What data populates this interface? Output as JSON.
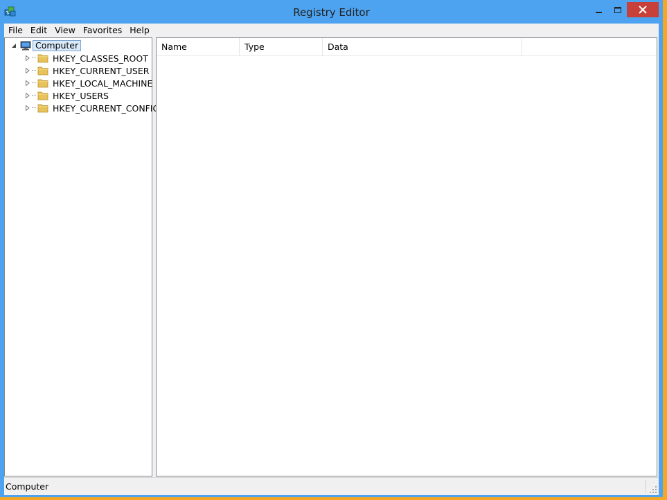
{
  "window": {
    "title": "Registry Editor",
    "accent_color": "#4da3ef",
    "close_color": "#c7403a",
    "desktop_color": "#f5a623"
  },
  "titlebar": {
    "icon": "regedit-icon",
    "buttons": [
      "minimize-icon",
      "maximize-icon",
      "close-icon"
    ]
  },
  "menu": {
    "items": [
      {
        "label": "File"
      },
      {
        "label": "Edit"
      },
      {
        "label": "View"
      },
      {
        "label": "Favorites"
      },
      {
        "label": "Help"
      }
    ]
  },
  "tree": {
    "root": {
      "label": "Computer",
      "icon": "computer-icon",
      "expanded": true,
      "selected": true
    },
    "keys": [
      {
        "label": "HKEY_CLASSES_ROOT",
        "icon": "folder-icon"
      },
      {
        "label": "HKEY_CURRENT_USER",
        "icon": "folder-icon"
      },
      {
        "label": "HKEY_LOCAL_MACHINE",
        "icon": "folder-icon"
      },
      {
        "label": "HKEY_USERS",
        "icon": "folder-icon"
      },
      {
        "label": "HKEY_CURRENT_CONFIG",
        "icon": "folder-icon"
      }
    ]
  },
  "list": {
    "columns": [
      {
        "label": "Name"
      },
      {
        "label": "Type"
      },
      {
        "label": "Data"
      }
    ]
  },
  "status": {
    "text": "Computer"
  }
}
